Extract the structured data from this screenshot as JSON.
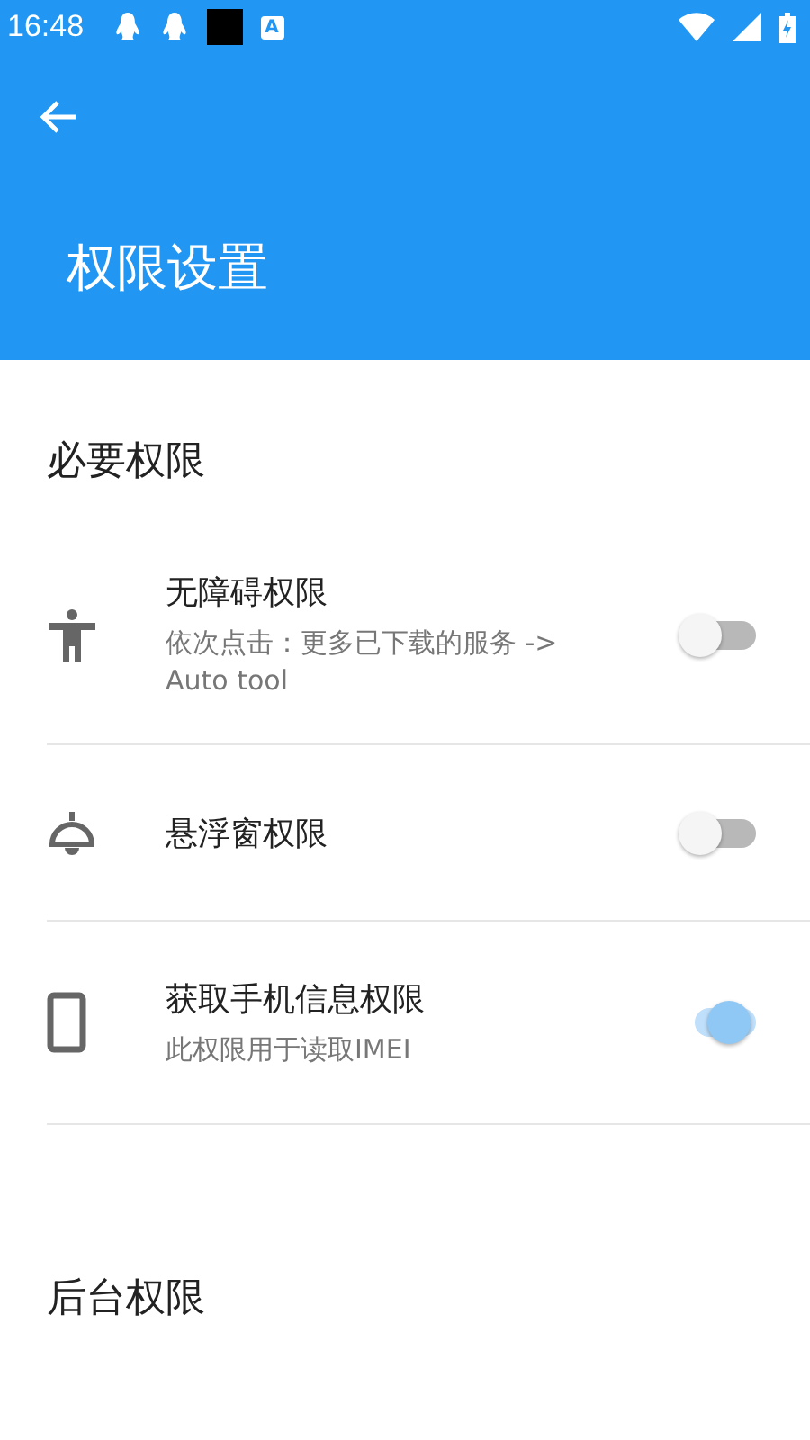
{
  "status_bar": {
    "time": "16:48",
    "notifications": [
      {
        "kind": "penguin"
      },
      {
        "kind": "penguin"
      },
      {
        "kind": "square"
      },
      {
        "kind": "letter",
        "label": "A"
      }
    ]
  },
  "app_bar": {
    "title": "权限设置"
  },
  "sections": [
    {
      "header": "必要权限",
      "items": [
        {
          "kind": "accessibility",
          "title": "无障碍权限",
          "subtitle": "依次点击：更多已下载的服务 -> Auto tool",
          "on": false
        },
        {
          "kind": "lamp",
          "title": "悬浮窗权限",
          "on": false
        },
        {
          "kind": "phone",
          "title": "获取手机信息权限",
          "subtitle": "此权限用于读取IMEI",
          "on": true
        }
      ]
    },
    {
      "header": "后台权限"
    }
  ]
}
